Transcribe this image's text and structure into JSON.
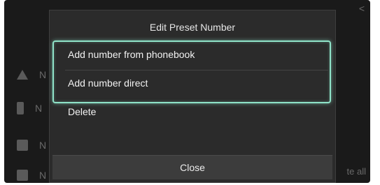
{
  "background": {
    "rows": [
      {
        "icon": "home-icon",
        "label": "N"
      },
      {
        "icon": "phone-icon",
        "label": "N"
      },
      {
        "icon": "preset-icon",
        "label": "N"
      },
      {
        "icon": "preset-icon",
        "label": "N"
      }
    ],
    "delete_all": "te all",
    "back": "<"
  },
  "dialog": {
    "title": "Edit Preset Number",
    "options": [
      "Add number from phonebook",
      "Add number direct",
      "Delete"
    ],
    "close_label": "Close",
    "highlight_color": "#8fe3c8"
  }
}
